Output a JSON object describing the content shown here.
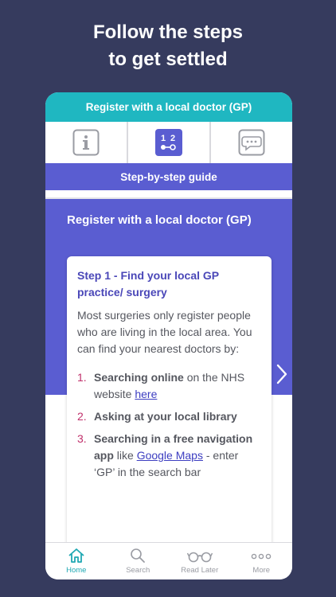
{
  "headline": {
    "line1": "Follow the steps",
    "line2": "to get settled"
  },
  "app": {
    "header_title": "Register with a local doctor (GP)",
    "mode_tabs": [
      {
        "icon": "info-icon",
        "active": false
      },
      {
        "icon": "numbered-steps-icon",
        "active": true
      },
      {
        "icon": "chat-bubble-icon",
        "active": false
      }
    ],
    "guide_label": "Step-by-step guide"
  },
  "content": {
    "section_title": "Register with a local doctor (GP)",
    "step": {
      "title": "Step 1 - Find your local GP practice/ surgery",
      "body": "Most surgeries only register people who are living in the local area. You can find your nearest doctors by:",
      "items": [
        {
          "num": "1.",
          "bold": "Searching online",
          "pre": " on the NHS website ",
          "link": "here",
          "post": ""
        },
        {
          "num": "2.",
          "bold": "Asking at your local library",
          "pre": "",
          "link": "",
          "post": ""
        },
        {
          "num": "3.",
          "bold": "Searching in a free navigation app",
          "pre": " like ",
          "link": "Google Maps",
          "post": " - enter ‘GP’ in the search bar"
        }
      ]
    }
  },
  "bottom_nav": [
    {
      "label": "Home",
      "icon": "home-icon",
      "active": true
    },
    {
      "label": "Search",
      "icon": "search-icon",
      "active": false
    },
    {
      "label": "Read Later",
      "icon": "glasses-icon",
      "active": false
    },
    {
      "label": "More",
      "icon": "more-icon",
      "active": false
    }
  ],
  "colors": {
    "background": "#363b5e",
    "header_teal": "#1fb7c1",
    "accent_purple": "#5a5dd1",
    "step_title": "#4a47b8",
    "list_number": "#c0306b",
    "link": "#3d3ec1"
  }
}
